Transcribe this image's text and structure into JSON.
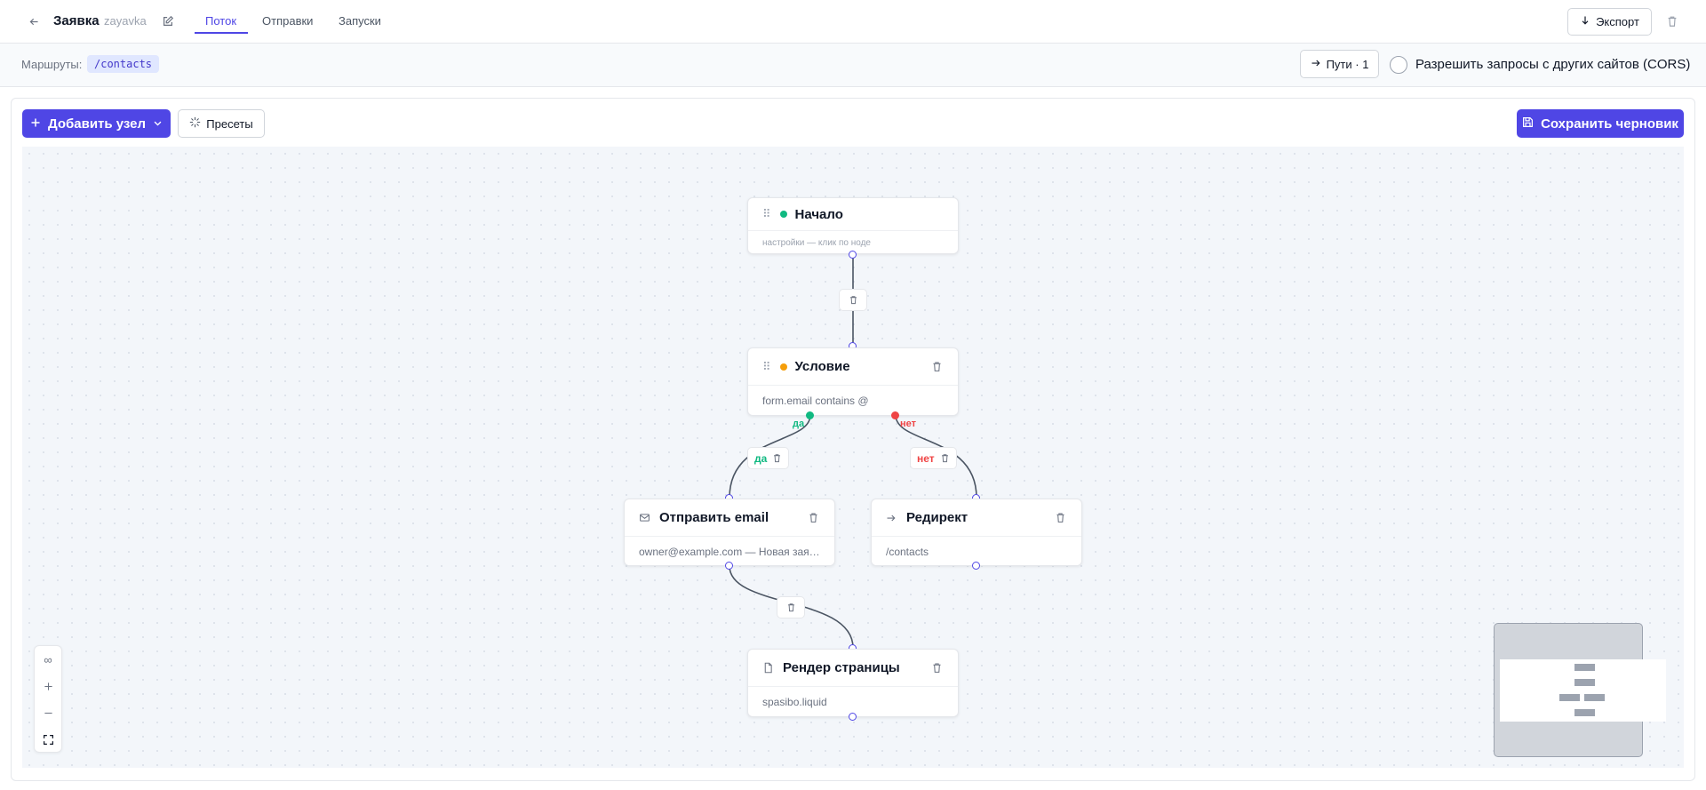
{
  "header": {
    "title": "Заявка",
    "slug": "zayavka",
    "tabs": [
      {
        "label": "Поток",
        "active": true
      },
      {
        "label": "Отправки",
        "active": false
      },
      {
        "label": "Запуски",
        "active": false
      }
    ],
    "export_label": "Экспорт"
  },
  "routes": {
    "label": "Маршруты:",
    "items": [
      "/contacts"
    ],
    "paths_label": "Пути · 1",
    "cors_label": "Разрешить запросы с других сайтов (CORS)",
    "cors_enabled": false
  },
  "toolbar": {
    "add_node_label": "Добавить узел",
    "presets_label": "Пресеты",
    "save_draft_label": "Сохранить черновик"
  },
  "nodes": {
    "start": {
      "title": "Начало",
      "subtitle": "настройки — клик по ноде",
      "dot_color": "#10b981"
    },
    "condition": {
      "title": "Условие",
      "subtitle": "form.email contains @",
      "dot_color": "#f59e0b"
    },
    "email": {
      "title": "Отправить email",
      "subtitle": "owner@example.com — Новая заявка"
    },
    "redirect": {
      "title": "Редирект",
      "subtitle": "/contacts"
    },
    "render": {
      "title": "Рендер страницы",
      "subtitle": "spasibo.liquid"
    }
  },
  "edges": {
    "yes_label": "да",
    "no_label": "нет"
  },
  "colors": {
    "accent": "#4f46e5",
    "yes": "#10b981",
    "no": "#ef4444",
    "condition": "#f59e0b"
  }
}
